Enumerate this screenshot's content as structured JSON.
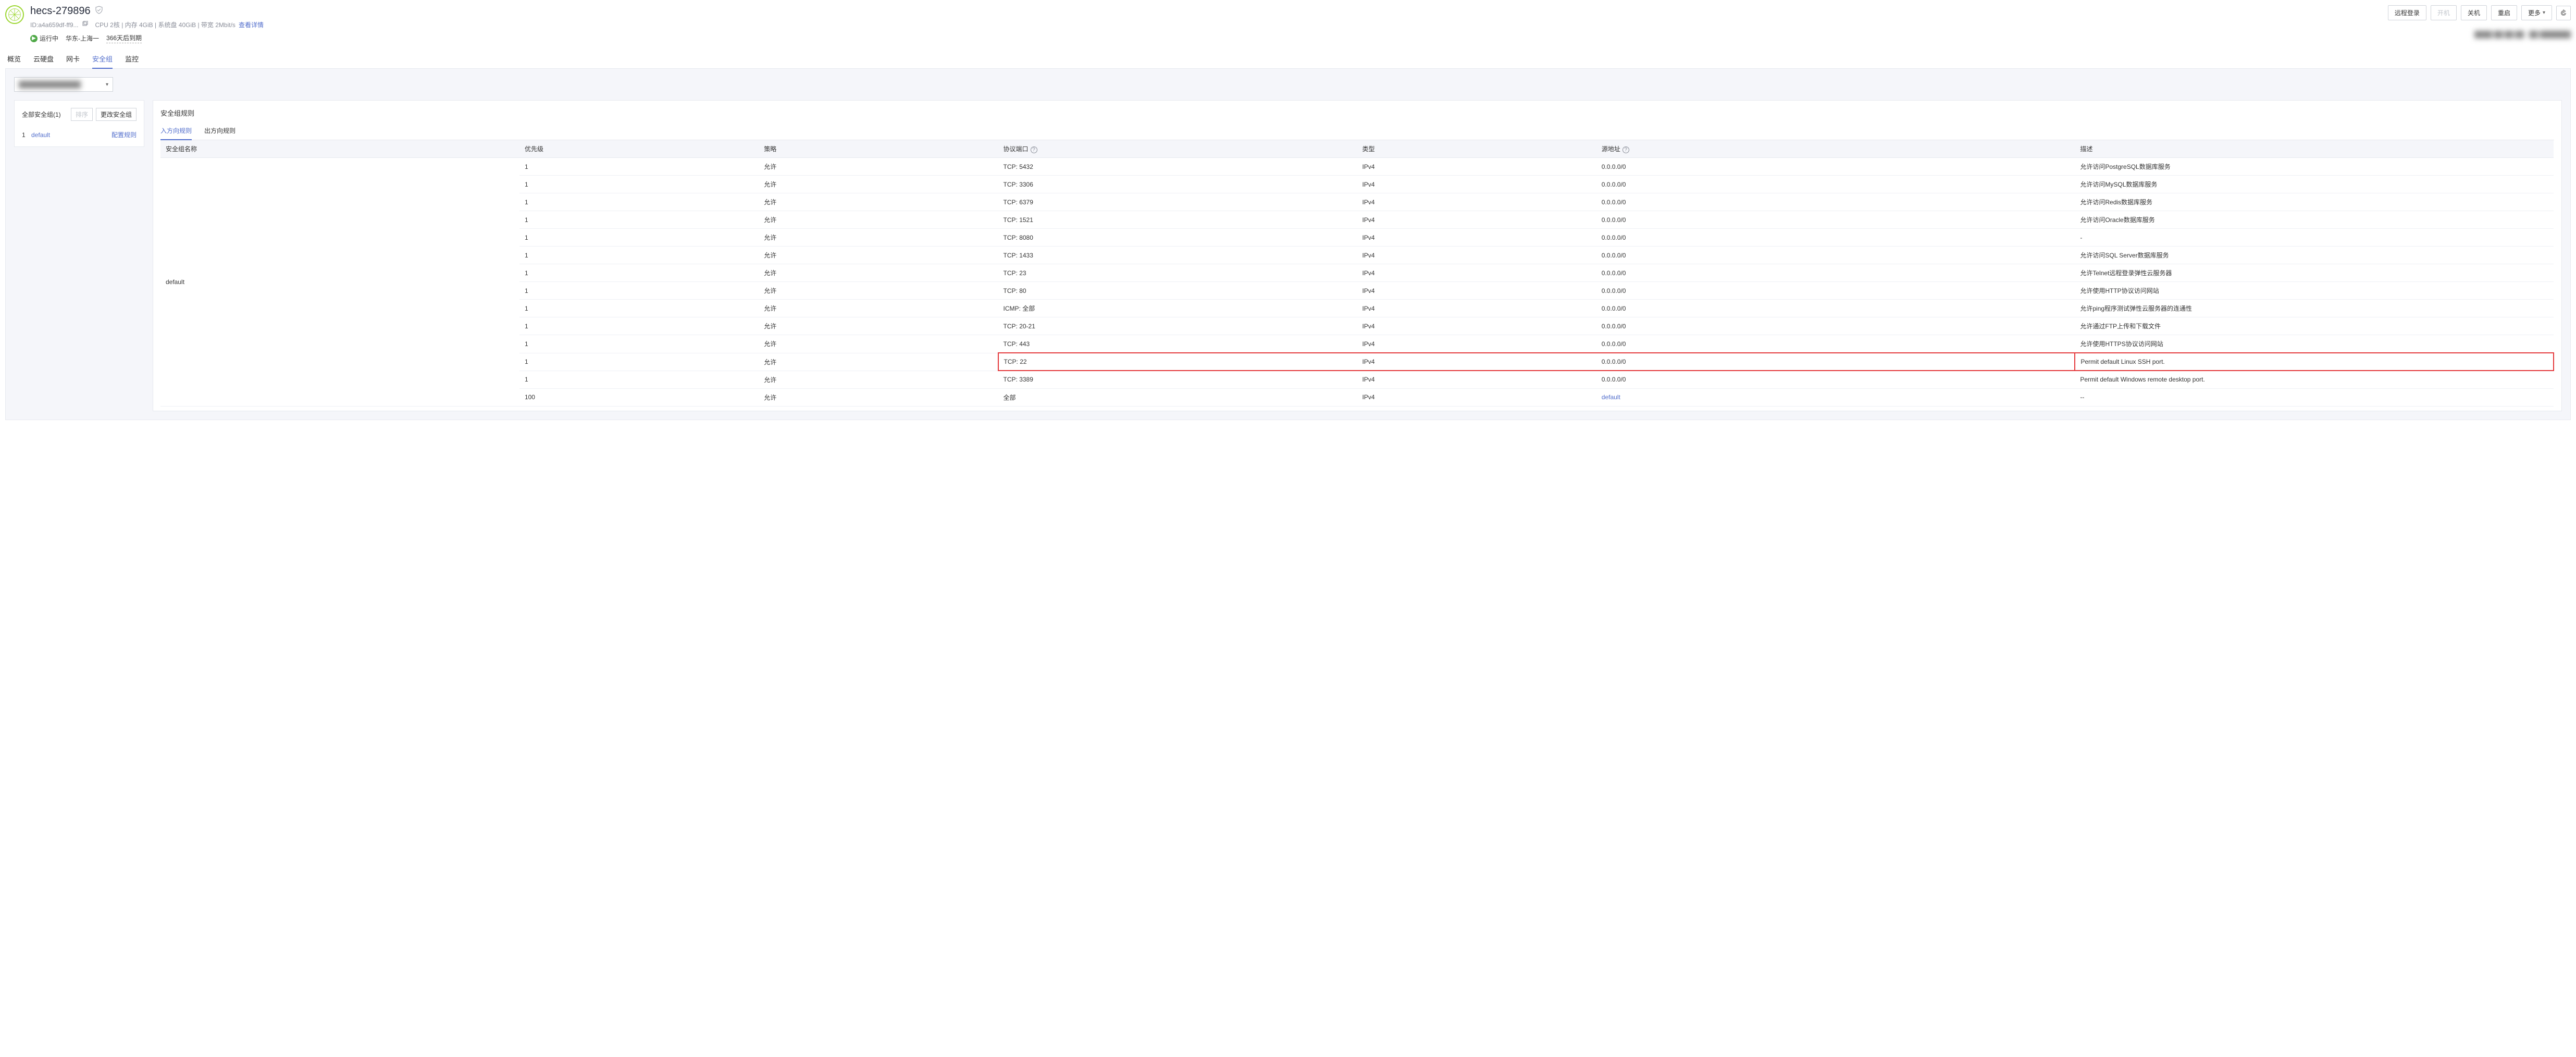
{
  "header": {
    "title": "hecs-279896",
    "id_label": "ID:a4a659df-ff9...",
    "specs": "CPU 2核 | 内存 4GiB | 系统盘 40GiB | 带宽 2Mbit/s",
    "detail_link": "查看详情",
    "status_label": "运行中",
    "region": "华东-上海一",
    "expiry": "366天后到期"
  },
  "actions": {
    "remote_login": "远程登录",
    "start": "开机",
    "stop": "关机",
    "restart": "重启",
    "more": "更多"
  },
  "tabs": {
    "overview": "概览",
    "disks": "云硬盘",
    "nics": "网卡",
    "security_groups": "安全组",
    "monitoring": "监控"
  },
  "nic_selector": {
    "value": ""
  },
  "side": {
    "all_label": "全部安全组(1)",
    "sort_btn": "排序",
    "change_btn": "更改安全组",
    "items": [
      {
        "idx": "1",
        "name": "default",
        "cfg": "配置规则"
      }
    ]
  },
  "rules_panel": {
    "title": "安全组规则",
    "tab_in": "入方向规则",
    "tab_out": "出方向规则",
    "columns": {
      "sg_name": "安全组名称",
      "priority": "优先级",
      "policy": "策略",
      "protocol_port": "协议端口",
      "type": "类型",
      "source": "源地址",
      "desc": "描述"
    },
    "group_name": "default",
    "rows": [
      {
        "priority": "1",
        "policy": "允许",
        "proto": "TCP: 5432",
        "type": "IPv4",
        "source": "0.0.0.0/0",
        "desc": "允许访问PostgreSQL数据库服务"
      },
      {
        "priority": "1",
        "policy": "允许",
        "proto": "TCP: 3306",
        "type": "IPv4",
        "source": "0.0.0.0/0",
        "desc": "允许访问MySQL数据库服务"
      },
      {
        "priority": "1",
        "policy": "允许",
        "proto": "TCP: 6379",
        "type": "IPv4",
        "source": "0.0.0.0/0",
        "desc": "允许访问Redis数据库服务"
      },
      {
        "priority": "1",
        "policy": "允许",
        "proto": "TCP: 1521",
        "type": "IPv4",
        "source": "0.0.0.0/0",
        "desc": "允许访问Oracle数据库服务"
      },
      {
        "priority": "1",
        "policy": "允许",
        "proto": "TCP: 8080",
        "type": "IPv4",
        "source": "0.0.0.0/0",
        "desc": "-"
      },
      {
        "priority": "1",
        "policy": "允许",
        "proto": "TCP: 1433",
        "type": "IPv4",
        "source": "0.0.0.0/0",
        "desc": "允许访问SQL Server数据库服务"
      },
      {
        "priority": "1",
        "policy": "允许",
        "proto": "TCP: 23",
        "type": "IPv4",
        "source": "0.0.0.0/0",
        "desc": "允许Telnet远程登录弹性云服务器"
      },
      {
        "priority": "1",
        "policy": "允许",
        "proto": "TCP: 80",
        "type": "IPv4",
        "source": "0.0.0.0/0",
        "desc": "允许使用HTTP协议访问网站"
      },
      {
        "priority": "1",
        "policy": "允许",
        "proto": "ICMP: 全部",
        "type": "IPv4",
        "source": "0.0.0.0/0",
        "desc": "允许ping程序测试弹性云服务器的连通性"
      },
      {
        "priority": "1",
        "policy": "允许",
        "proto": "TCP: 20-21",
        "type": "IPv4",
        "source": "0.0.0.0/0",
        "desc": "允许通过FTP上传和下载文件"
      },
      {
        "priority": "1",
        "policy": "允许",
        "proto": "TCP: 443",
        "type": "IPv4",
        "source": "0.0.0.0/0",
        "desc": "允许使用HTTPS协议访问网站"
      },
      {
        "priority": "1",
        "policy": "允许",
        "proto": "TCP: 22",
        "type": "IPv4",
        "source": "0.0.0.0/0",
        "desc": "Permit default Linux SSH port.",
        "highlight": true
      },
      {
        "priority": "1",
        "policy": "允许",
        "proto": "TCP: 3389",
        "type": "IPv4",
        "source": "0.0.0.0/0",
        "desc": "Permit default Windows remote desktop port."
      },
      {
        "priority": "100",
        "policy": "允许",
        "proto": "全部",
        "type": "IPv4",
        "source": "default",
        "source_link": true,
        "desc": "--"
      }
    ]
  }
}
